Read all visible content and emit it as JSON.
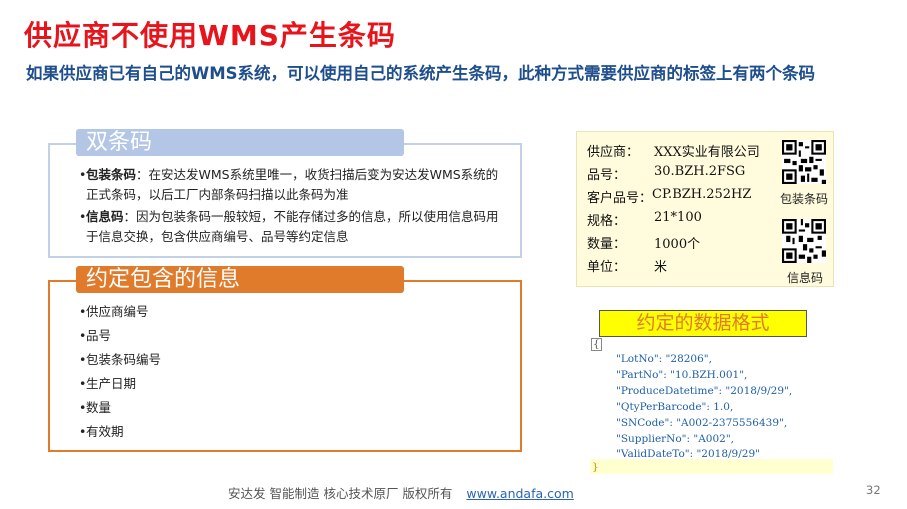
{
  "title": "供应商不使用WMS产生条码",
  "subtitle": "如果供应商已有自己的WMS系统，可以使用自己的系统产生条码，此种方式需要供应商的标签上有两个条码",
  "section1": {
    "heading": "双条码",
    "items": [
      {
        "term": "包装条码",
        "text": "：在安达发WMS系统里唯一，收货扫描后变为安达发WMS系统的正式条码，以后工厂内部条码扫描以此条码为准"
      },
      {
        "term": "信息码",
        "text": "：因为包装条码一般较短，不能存储过多的信息，所以使用信息码用于信息交换，包含供应商编号、品号等约定信息"
      }
    ]
  },
  "section2": {
    "heading": "约定包含的信息",
    "items": [
      "供应商编号",
      "品号",
      "包装条码编号",
      "生产日期",
      "数量",
      "有效期"
    ]
  },
  "label": {
    "rows": [
      {
        "key": "供应商：",
        "value": "XXX实业有限公司"
      },
      {
        "key": "品号：",
        "value": "30.BZH.2FSG"
      },
      {
        "key": "客户品号：",
        "value": "CP.BZH.252HZ"
      },
      {
        "key": "规格：",
        "value": "21*100"
      },
      {
        "key": "数量：",
        "value": "1000个"
      },
      {
        "key": "单位：",
        "value": "米"
      }
    ],
    "qr1_caption": "包装条码",
    "qr2_caption": "信息码",
    "qr_icon": "qr-code-icon"
  },
  "format": {
    "heading": "约定的数据格式",
    "open_brace": "{",
    "close_brace": "}",
    "lines": [
      "\"LotNo\": \"28206\",",
      "\"PartNo\": \"10.BZH.001\",",
      "\"ProduceDatetime\": \"2018/9/29\",",
      "\"QtyPerBarcode\": 1.0,",
      "\"SNCode\": \"A002-2375556439\",",
      "\"SupplierNo\": \"A002\",",
      "\"ValidDateTo\": \"2018/9/29\""
    ]
  },
  "footer": {
    "text": "安达发   智能制造 核心技术原厂   版权所有",
    "link": "www.andafa.com",
    "page": "32"
  },
  "colors": {
    "title": "#e8141b",
    "subtitle": "#1f4e8c",
    "section1_accent": "#b3c6e6",
    "section2_accent": "#e07b2c",
    "highlight": "#ffff00"
  }
}
